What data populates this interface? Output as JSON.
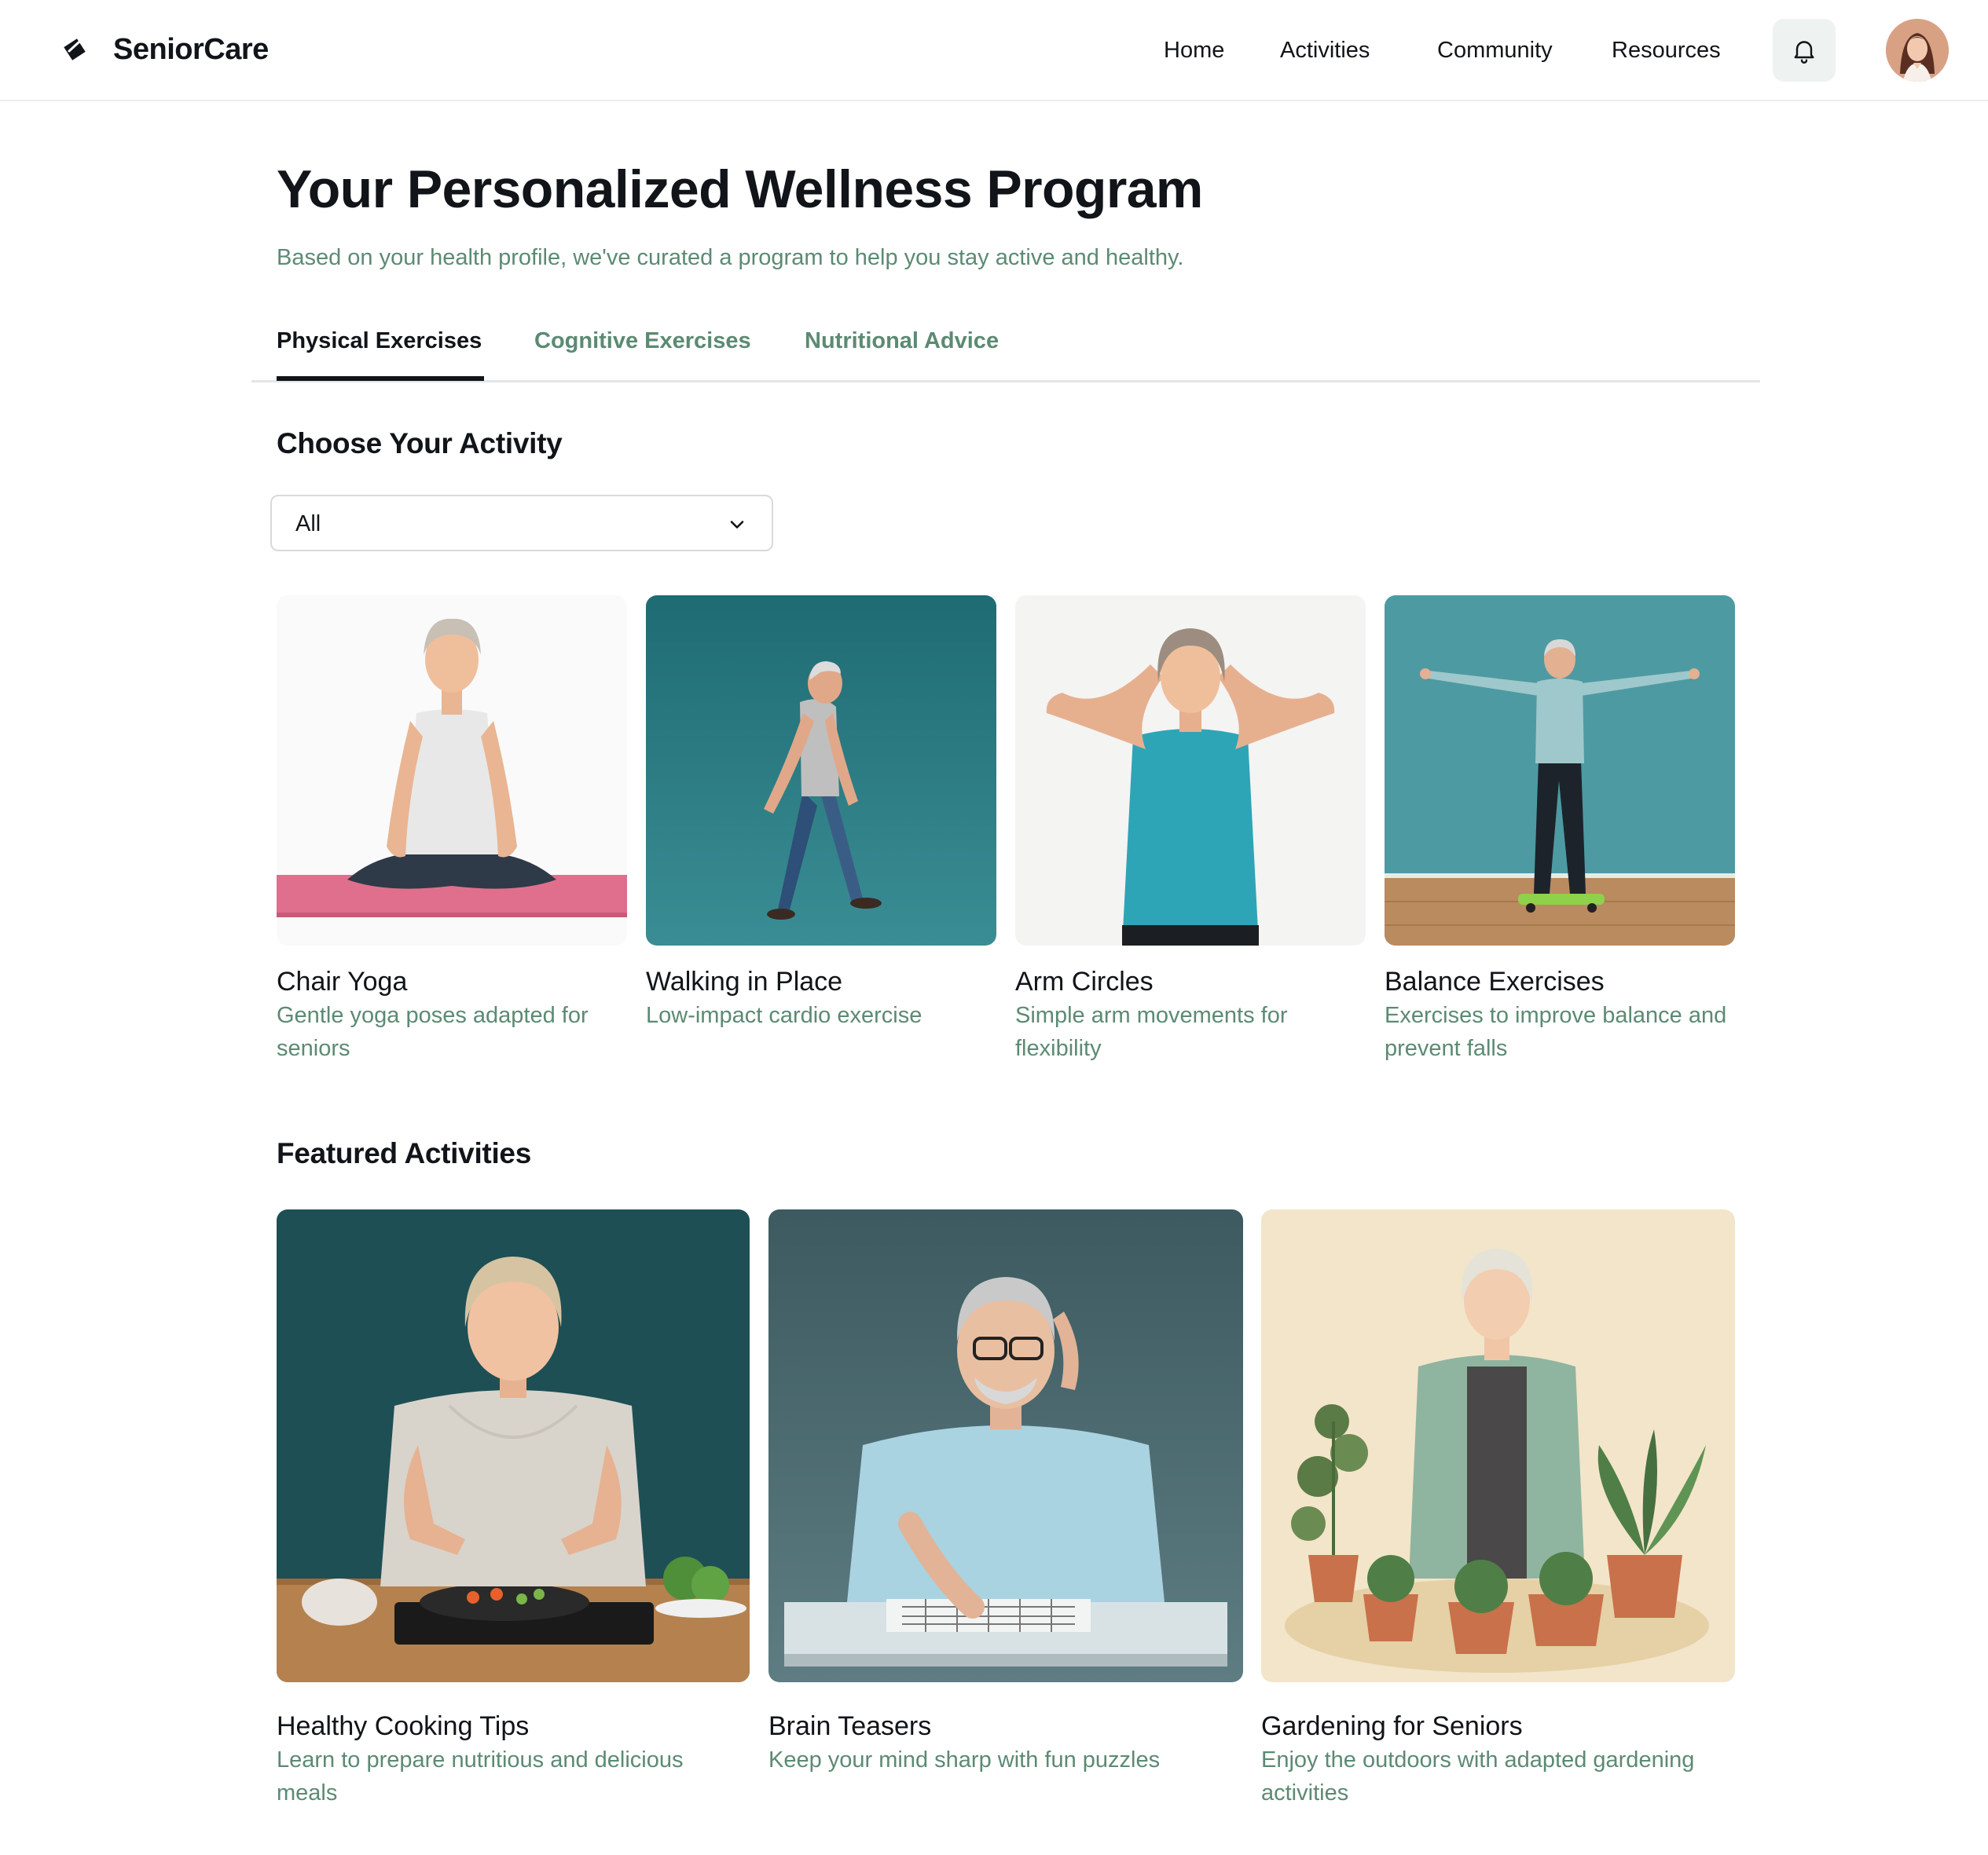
{
  "header": {
    "brand": "SeniorCare",
    "nav": [
      "Home",
      "Activities",
      "Community",
      "Resources"
    ]
  },
  "intro": {
    "title": "Your Personalized Wellness Program",
    "subtitle": "Based on your health profile, we've curated a program to help you stay active and healthy."
  },
  "tabs": [
    {
      "label": "Physical Exercises",
      "active": true
    },
    {
      "label": "Cognitive Exercises",
      "active": false
    },
    {
      "label": "Nutritional Advice",
      "active": false
    }
  ],
  "choose": {
    "title": "Choose Your Activity",
    "filter_value": "All"
  },
  "activities": [
    {
      "title": "Chair Yoga",
      "description": "Gentle yoga poses adapted for seniors"
    },
    {
      "title": "Walking in Place",
      "description": "Low-impact cardio exercise"
    },
    {
      "title": "Arm Circles",
      "description": "Simple arm movements for flexibility"
    },
    {
      "title": "Balance Exercises",
      "description": "Exercises to improve balance and prevent falls"
    }
  ],
  "featured": {
    "title": "Featured Activities",
    "items": [
      {
        "title": "Healthy Cooking Tips",
        "description": "Learn to prepare nutritious and delicious meals"
      },
      {
        "title": "Brain Teasers",
        "description": "Keep your mind sharp with fun puzzles"
      },
      {
        "title": "Gardening for Seniors",
        "description": "Enjoy the outdoors with adapted gardening activities"
      }
    ]
  },
  "colors": {
    "accent_text": "#5c8a73",
    "text": "#111418",
    "teal_bg": "#2d7a82"
  },
  "icons": [
    "logo-icon",
    "bell-icon",
    "chevron-down-icon"
  ]
}
